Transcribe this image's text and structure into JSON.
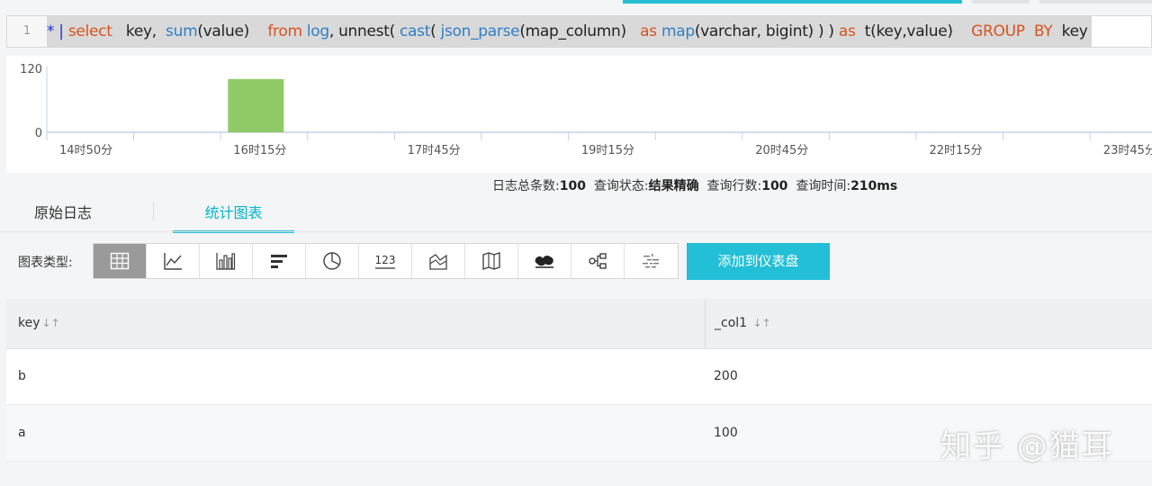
{
  "query": {
    "line_number": "1",
    "tokens": [
      {
        "text": "* | ",
        "color": "#1b2fd6"
      },
      {
        "text": "select",
        "color": "#d9531e"
      },
      {
        "text": "   key,  ",
        "color": "#222222"
      },
      {
        "text": "sum",
        "color": "#2f7fc6"
      },
      {
        "text": "(value)",
        "color": "#222222"
      },
      {
        "text": "    from",
        "color": "#d9531e"
      },
      {
        "text": " log",
        "color": "#2f7fc6"
      },
      {
        "text": ", unnest( ",
        "color": "#222222"
      },
      {
        "text": "cast",
        "color": "#2f7fc6"
      },
      {
        "text": "( ",
        "color": "#222222"
      },
      {
        "text": "json_parse",
        "color": "#2f7fc6"
      },
      {
        "text": "(map_column)   ",
        "color": "#222222"
      },
      {
        "text": "as",
        "color": "#d9531e"
      },
      {
        "text": " map",
        "color": "#2f7fc6"
      },
      {
        "text": "(varchar, bigint) ) ) ",
        "color": "#222222"
      },
      {
        "text": "as",
        "color": "#d9531e"
      },
      {
        "text": "  t(key,value)    ",
        "color": "#222222"
      },
      {
        "text": "GROUP  BY",
        "color": "#d9531e"
      },
      {
        "text": "  key",
        "color": "#222222"
      }
    ]
  },
  "histogram": {
    "y_ticks": [
      "120",
      "0"
    ],
    "y_max": 120,
    "x_labels": [
      "14时50分",
      "16时15分",
      "17时45分",
      "19时15分",
      "20时45分",
      "22时15分",
      "23时45分"
    ],
    "bars": [
      {
        "slot": 1,
        "value": 100,
        "color": "#8fca67"
      }
    ],
    "axis_color": "#c5d2e6"
  },
  "stats": {
    "total_label": "日志总条数:",
    "total_value": "100",
    "status_label": "查询状态:",
    "status_value": "结果精确",
    "rows_label": "查询行数:",
    "rows_value": "100",
    "time_label": "查询时间:",
    "time_value": "210ms"
  },
  "tabs": [
    {
      "label": "原始日志",
      "active": false
    },
    {
      "label": "统计图表",
      "active": true
    }
  ],
  "chart_types": {
    "label": "图表类型:",
    "items": [
      {
        "icon": "table-icon",
        "active": true
      },
      {
        "icon": "line-chart-icon",
        "active": false
      },
      {
        "icon": "bar-chart-icon",
        "active": false
      },
      {
        "icon": "horizontal-bar-icon",
        "active": false
      },
      {
        "icon": "pie-chart-icon",
        "active": false
      },
      {
        "icon": "number-icon",
        "active": false,
        "text": "123"
      },
      {
        "icon": "area-chart-icon",
        "active": false
      },
      {
        "icon": "map-icon",
        "active": false
      },
      {
        "icon": "world-map-icon",
        "active": false
      },
      {
        "icon": "flow-icon",
        "active": false
      },
      {
        "icon": "word-cloud-icon",
        "active": false
      }
    ]
  },
  "add_button": "添加到仪表盘",
  "table": {
    "columns": [
      "key",
      "_col1"
    ],
    "sort_glyph": "↓↑",
    "rows": [
      [
        "b",
        "200"
      ],
      [
        "a",
        "100"
      ]
    ]
  },
  "colors": {
    "accent": "#22bfd7",
    "top_strip": "#26bfd6"
  },
  "watermark": "知乎 @猫耳"
}
